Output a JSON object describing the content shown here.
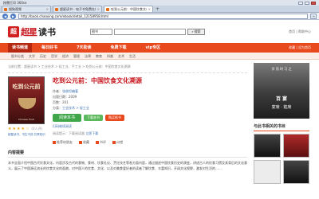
{
  "browser": {
    "title": "按需打印 360se",
    "tabs": [
      {
        "label": "搜狗视频",
        "active": false
      },
      {
        "label": "超星读书 - 电子书免费在线阅读",
        "active": false
      },
      {
        "label": "吃到公元前：中国饮食文化溯源",
        "active": true
      }
    ],
    "new_tab": "+",
    "url": "http://book.chaoxing.com/ebook/detail_12158958.html",
    "go": "→"
  },
  "site": {
    "logo_mark": "超",
    "logo_text": "超星",
    "logo_sub": "读书",
    "search_category": "图书",
    "search_placeholder": "",
    "search_button": "搜索",
    "head_links": "首页 | 帮助中心"
  },
  "nav": {
    "home": "读书频道",
    "items": [
      "每日好书",
      "7天助读",
      "免费下载",
      "vip专区"
    ],
    "right": "收藏 | 设为首页"
  },
  "subnav": [
    "图书分类",
    "文学",
    "历史",
    "哲学",
    "经济",
    "管理",
    "法律",
    "教育",
    "科普",
    "艺术",
    "生活"
  ],
  "breadcrumb": "当前位置：超星读书 > 工业技术 > 轻工业、手工业 > 吃到公元前：中国饮食文化溯源",
  "book": {
    "title": "吃到公元前：中国饮食文化溯源",
    "cover_title": "吃到公元前",
    "cover_sub": "Chinese Food",
    "author_label": "作者：",
    "author": "张俊恒编著",
    "year_label": "出版日期：",
    "year": "2009",
    "pages_label": "页数：",
    "pages": "201",
    "category_label": "分类：",
    "category": "工业技术 > 轻工业",
    "read_button": "阅读本书",
    "download_button": "下载本书",
    "buy_button": "购买纸书",
    "qr_note": "扫码继续阅读",
    "tip": "阅读提示：下载阅读器",
    "tip_link": "立即下载",
    "actions": [
      "推荐给朋友",
      "收藏",
      "书评",
      "纠错"
    ],
    "rating": "(0人评)",
    "cover_note": "超星读书，书生不孤\n共享知识"
  },
  "summary": {
    "heading": "内容提要",
    "text": "本书全面介绍中国古代饮食文化，内容涉及古代的食物、食材、饮食礼仪、烹饪技艺等各方面内容，通过描述中国饮食历史的演变，讲述古人的饮食习惯及其背后的文化意义，展示了中国源远流长的饮食文化的面貌，对中国人的饮食、文化、以及对美食爱好者的读者了解饮食、丰富知识，开阔文化视野，激发对生活的……"
  },
  "sidebar": {
    "ad_line1": "学 而 时 习 之",
    "ad_line2": "百 宴",
    "ad_line3": "宴席 · 筵席",
    "related_title": "与此书相关的书目"
  }
}
